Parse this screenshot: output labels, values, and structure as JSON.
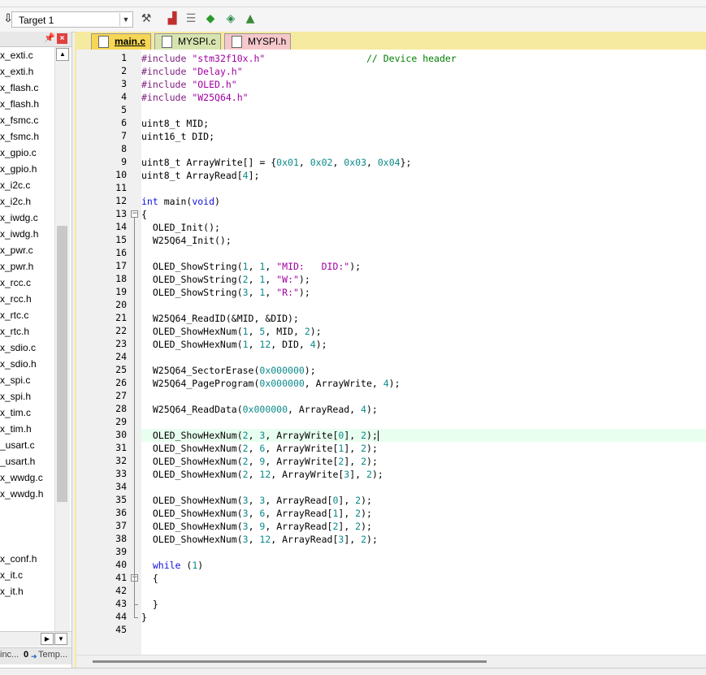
{
  "toolbar": {
    "target": "Target 1",
    "icons": [
      "download-icon",
      "target-options-icon",
      "manage-components-icon",
      "select-pack-icon",
      "pack-installer-icon",
      "run-time-environment-icon",
      "manage-project-icon"
    ]
  },
  "project_panel": {
    "files": [
      {
        "name": "x_exti.c"
      },
      {
        "name": "x_exti.h"
      },
      {
        "name": "x_flash.c"
      },
      {
        "name": "x_flash.h"
      },
      {
        "name": "x_fsmc.c"
      },
      {
        "name": "x_fsmc.h"
      },
      {
        "name": "x_gpio.c"
      },
      {
        "name": "x_gpio.h"
      },
      {
        "name": "x_i2c.c"
      },
      {
        "name": "x_i2c.h"
      },
      {
        "name": "x_iwdg.c"
      },
      {
        "name": "x_iwdg.h"
      },
      {
        "name": "x_pwr.c"
      },
      {
        "name": "x_pwr.h"
      },
      {
        "name": "x_rcc.c"
      },
      {
        "name": "x_rcc.h"
      },
      {
        "name": "x_rtc.c"
      },
      {
        "name": "x_rtc.h"
      },
      {
        "name": "x_sdio.c"
      },
      {
        "name": "x_sdio.h"
      },
      {
        "name": "x_spi.c"
      },
      {
        "name": "x_spi.h"
      },
      {
        "name": "x_tim.c"
      },
      {
        "name": "x_tim.h"
      },
      {
        "name": "_usart.c"
      },
      {
        "name": "_usart.h"
      },
      {
        "name": "x_wwdg.c"
      },
      {
        "name": "x_wwdg.h"
      }
    ],
    "files_lower": [
      {
        "name": "x_conf.h"
      },
      {
        "name": "x_it.c"
      },
      {
        "name": "x_it.h"
      }
    ],
    "bottom_tabs": [
      "inc...",
      "Temp..."
    ],
    "bottom_tab_prefix": "0"
  },
  "editor": {
    "tabs": [
      {
        "label": "main.c",
        "active": true
      },
      {
        "label": "MYSPI.c",
        "active": false
      },
      {
        "label": "MYSPI.h",
        "active": false
      }
    ],
    "lines": [
      {
        "n": "1",
        "html": "<span class='pp'>#include</span> <span class='str'>\"stm32f10x.h\"</span>                  <span class='cmt'>// Device header</span>"
      },
      {
        "n": "2",
        "html": "<span class='pp'>#include</span> <span class='str'>\"Delay.h\"</span>"
      },
      {
        "n": "3",
        "html": "<span class='pp'>#include</span> <span class='str'>\"OLED.h\"</span>"
      },
      {
        "n": "4",
        "html": "<span class='pp'>#include</span> <span class='str'>\"W25Q64.h\"</span>"
      },
      {
        "n": "5",
        "html": ""
      },
      {
        "n": "6",
        "html": "uint8_t MID;"
      },
      {
        "n": "7",
        "html": "uint16_t DID;"
      },
      {
        "n": "8",
        "html": ""
      },
      {
        "n": "9",
        "html": "uint8_t ArrayWrite[] = {<span class='num'>0x01</span>, <span class='num'>0x02</span>, <span class='num'>0x03</span>, <span class='num'>0x04</span>};"
      },
      {
        "n": "10",
        "html": "uint8_t ArrayRead[<span class='num'>4</span>];"
      },
      {
        "n": "11",
        "html": ""
      },
      {
        "n": "12",
        "html": "<span class='kw'>int</span> main(<span class='kw'>void</span>)"
      },
      {
        "n": "13",
        "html": "{"
      },
      {
        "n": "14",
        "html": "  OLED_Init();"
      },
      {
        "n": "15",
        "html": "  W25Q64_Init();"
      },
      {
        "n": "16",
        "html": ""
      },
      {
        "n": "17",
        "html": "  OLED_ShowString(<span class='num'>1</span>, <span class='num'>1</span>, <span class='str'>\"MID:   DID:\"</span>);"
      },
      {
        "n": "18",
        "html": "  OLED_ShowString(<span class='num'>2</span>, <span class='num'>1</span>, <span class='str'>\"W:\"</span>);"
      },
      {
        "n": "19",
        "html": "  OLED_ShowString(<span class='num'>3</span>, <span class='num'>1</span>, <span class='str'>\"R:\"</span>);"
      },
      {
        "n": "20",
        "html": ""
      },
      {
        "n": "21",
        "html": "  W25Q64_ReadID(&amp;MID, &amp;DID);"
      },
      {
        "n": "22",
        "html": "  OLED_ShowHexNum(<span class='num'>1</span>, <span class='num'>5</span>, MID, <span class='num'>2</span>);"
      },
      {
        "n": "23",
        "html": "  OLED_ShowHexNum(<span class='num'>1</span>, <span class='num'>12</span>, DID, <span class='num'>4</span>);"
      },
      {
        "n": "24",
        "html": ""
      },
      {
        "n": "25",
        "html": "  W25Q64_SectorErase(<span class='num'>0x000000</span>);"
      },
      {
        "n": "26",
        "html": "  W25Q64_PageProgram(<span class='num'>0x000000</span>, ArrayWrite, <span class='num'>4</span>);"
      },
      {
        "n": "27",
        "html": ""
      },
      {
        "n": "28",
        "html": "  W25Q64_ReadData(<span class='num'>0x000000</span>, ArrayRead, <span class='num'>4</span>);"
      },
      {
        "n": "29",
        "html": ""
      },
      {
        "n": "30",
        "html": "  OLED_ShowHexNum(<span class='num'>2</span>, <span class='num'>3</span>, ArrayWrite[<span class='num'>0</span>], <span class='num'>2</span>);<span class='cursor'></span>"
      },
      {
        "n": "31",
        "html": "  OLED_ShowHexNum(<span class='num'>2</span>, <span class='num'>6</span>, ArrayWrite[<span class='num'>1</span>], <span class='num'>2</span>);"
      },
      {
        "n": "32",
        "html": "  OLED_ShowHexNum(<span class='num'>2</span>, <span class='num'>9</span>, ArrayWrite[<span class='num'>2</span>], <span class='num'>2</span>);"
      },
      {
        "n": "33",
        "html": "  OLED_ShowHexNum(<span class='num'>2</span>, <span class='num'>12</span>, ArrayWrite[<span class='num'>3</span>], <span class='num'>2</span>);"
      },
      {
        "n": "34",
        "html": ""
      },
      {
        "n": "35",
        "html": "  OLED_ShowHexNum(<span class='num'>3</span>, <span class='num'>3</span>, ArrayRead[<span class='num'>0</span>], <span class='num'>2</span>);"
      },
      {
        "n": "36",
        "html": "  OLED_ShowHexNum(<span class='num'>3</span>, <span class='num'>6</span>, ArrayRead[<span class='num'>1</span>], <span class='num'>2</span>);"
      },
      {
        "n": "37",
        "html": "  OLED_ShowHexNum(<span class='num'>3</span>, <span class='num'>9</span>, ArrayRead[<span class='num'>2</span>], <span class='num'>2</span>);"
      },
      {
        "n": "38",
        "html": "  OLED_ShowHexNum(<span class='num'>3</span>, <span class='num'>12</span>, ArrayRead[<span class='num'>3</span>], <span class='num'>2</span>);"
      },
      {
        "n": "39",
        "html": ""
      },
      {
        "n": "40",
        "html": "  <span class='kw'>while</span> (<span class='num'>1</span>)"
      },
      {
        "n": "41",
        "html": "  {"
      },
      {
        "n": "42",
        "html": ""
      },
      {
        "n": "43",
        "html": "  }"
      },
      {
        "n": "44",
        "html": "}"
      },
      {
        "n": "45",
        "html": ""
      }
    ],
    "current_line": "30",
    "fold_markers": [
      "13",
      "41"
    ]
  }
}
